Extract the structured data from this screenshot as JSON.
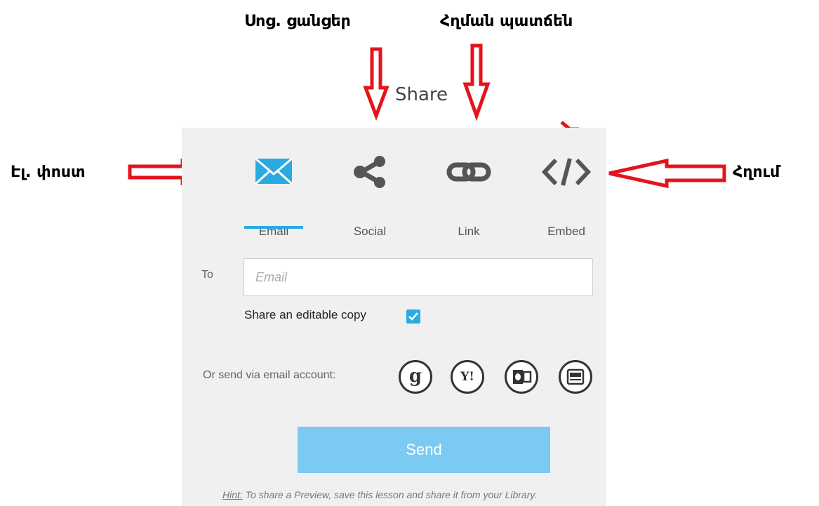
{
  "annotations": {
    "social": "Սոց. ցանցեր",
    "link": "Հղման պատճեն",
    "email": "Էլ. փոստ",
    "embed": "Հղում"
  },
  "dialog": {
    "title": "Share",
    "tabs": [
      {
        "label": "Email",
        "icon": "envelope-icon",
        "active": true
      },
      {
        "label": "Social",
        "icon": "share-icon",
        "active": false
      },
      {
        "label": "Link",
        "icon": "link-icon",
        "active": false
      },
      {
        "label": "Embed",
        "icon": "code-icon",
        "active": false
      }
    ],
    "to_label": "To",
    "email_placeholder": "Email",
    "email_value": "",
    "share_copy_label": "Share an editable copy",
    "share_copy_checked": true,
    "or_send_label": "Or send via email account:",
    "accounts": [
      "gmail-icon",
      "yahoo-icon",
      "outlook-icon",
      "mail-app-icon"
    ],
    "account_glyphs": {
      "gmail": "g",
      "yahoo": "Y!"
    },
    "send_label": "Send",
    "hint_prefix": "Hint:",
    "hint_text": " To share a Preview, save this lesson and share it from your Library."
  },
  "colors": {
    "accent": "#29abe2",
    "send_button": "#7bcaf1",
    "arrow": "#e3141c",
    "panel": "#f0f0f0"
  }
}
